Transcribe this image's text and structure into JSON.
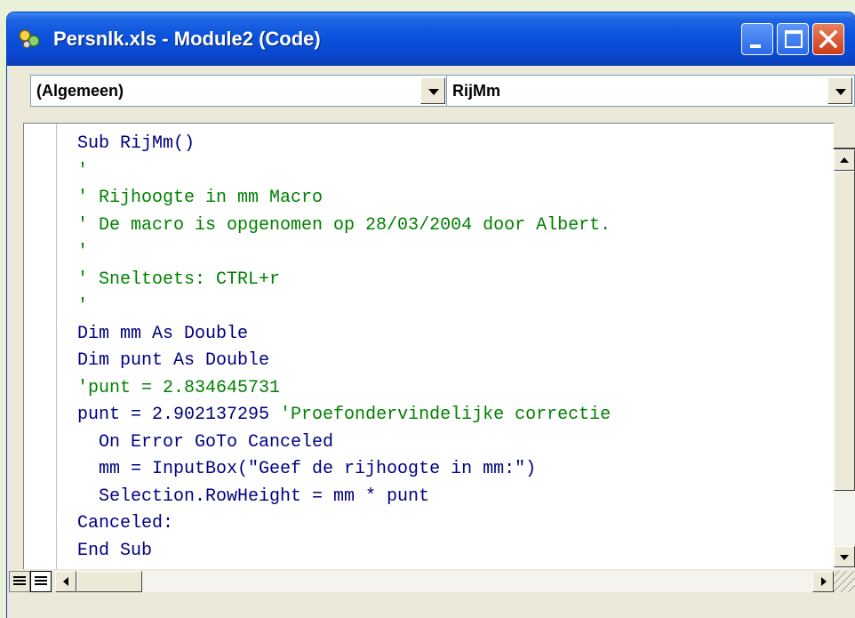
{
  "window": {
    "title": "Persnlk.xls - Module2 (Code)",
    "icon": "vba-module-icon",
    "buttons": {
      "minimize": "minimize-icon",
      "maximize": "maximize-icon",
      "close": "close-icon"
    }
  },
  "combos": {
    "object": {
      "value": "(Algemeen)"
    },
    "procedure": {
      "value": "RijMm"
    }
  },
  "code": {
    "lines": [
      {
        "text": "Sub RijMm()",
        "type": "code"
      },
      {
        "text": "'",
        "type": "comment"
      },
      {
        "text": "' Rijhoogte in mm Macro",
        "type": "comment"
      },
      {
        "text": "' De macro is opgenomen op 28/03/2004 door Albert.",
        "type": "comment"
      },
      {
        "text": "'",
        "type": "comment"
      },
      {
        "text": "' Sneltoets: CTRL+r",
        "type": "comment"
      },
      {
        "text": "'",
        "type": "comment"
      },
      {
        "text": "Dim mm As Double",
        "type": "code"
      },
      {
        "text": "Dim punt As Double",
        "type": "code"
      },
      {
        "text": "'punt = 2.834645731",
        "type": "comment"
      },
      {
        "code": "punt = 2.902137295 ",
        "comment": "'Proefondervindelijke correctie",
        "type": "mixed"
      },
      {
        "text": "  On Error GoTo Canceled",
        "type": "code"
      },
      {
        "text": "  mm = InputBox(\"Geef de rijhoogte in mm:\")",
        "type": "code"
      },
      {
        "text": "  Selection.RowHeight = mm * punt",
        "type": "code"
      },
      {
        "text": "Canceled:",
        "type": "code"
      },
      {
        "text": "End Sub",
        "type": "code"
      }
    ]
  },
  "colors": {
    "code": "#000080",
    "comment": "#008000",
    "titlebar": "#0a52dd",
    "background": "#e9f2d9"
  }
}
